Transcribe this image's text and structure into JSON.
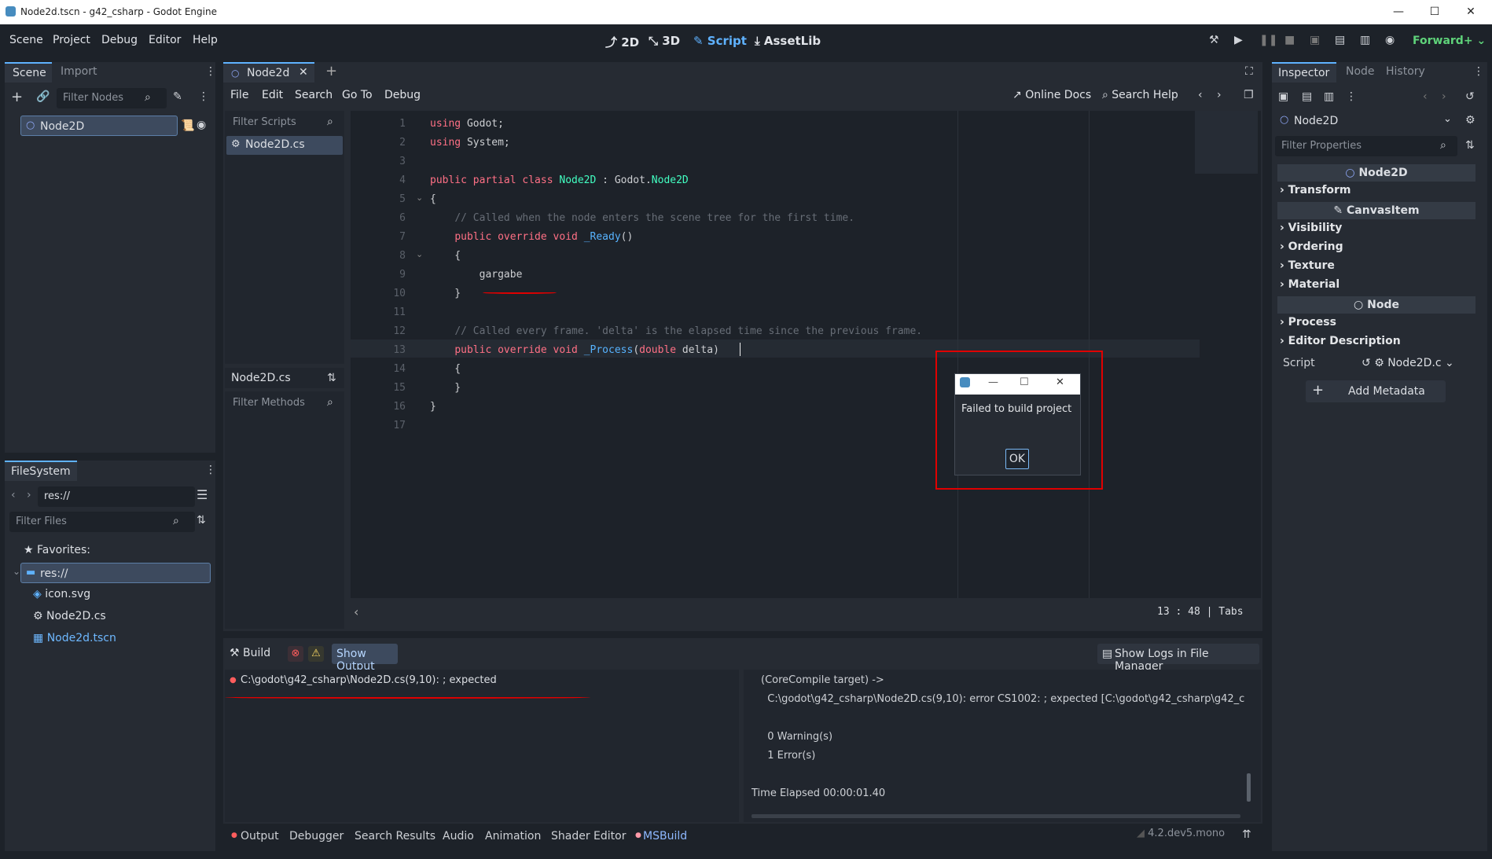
{
  "window": {
    "title": "Node2d.tscn - g42_csharp - Godot Engine",
    "minimize": "—",
    "maximize": "☐",
    "close": "✕"
  },
  "menu": {
    "items": [
      "Scene",
      "Project",
      "Debug",
      "Editor",
      "Help"
    ]
  },
  "workspaces": {
    "2d": "2D",
    "3d": "3D",
    "script": "Script",
    "assetlib": "AssetLib"
  },
  "renderer": "Forward+",
  "scene_dock": {
    "tab_scene": "Scene",
    "tab_import": "Import",
    "filter_placeholder": "Filter Nodes",
    "node": "Node2D"
  },
  "filesystem": {
    "tab": "FileSystem",
    "path": "res://",
    "filter_placeholder": "Filter Files",
    "favorites": "Favorites:",
    "root": "res://",
    "files": [
      "icon.svg",
      "Node2D.cs",
      "Node2d.tscn"
    ]
  },
  "editor_tabs": {
    "active": "Node2d",
    "add": "+"
  },
  "script_menu": {
    "items": [
      "File",
      "Edit",
      "Search",
      "Go To",
      "Debug"
    ],
    "online_docs": "Online Docs",
    "search_help": "Search Help"
  },
  "script_list": {
    "filter_placeholder": "Filter Scripts",
    "items": [
      "Node2D.cs"
    ],
    "current": "Node2D.cs",
    "methods_placeholder": "Filter Methods"
  },
  "code": {
    "lines": [
      [
        [
          "kw",
          "using"
        ],
        [
          "tx",
          " Godot;"
        ]
      ],
      [
        [
          "kw",
          "using"
        ],
        [
          "tx",
          " System;"
        ]
      ],
      [],
      [
        [
          "kw",
          "public partial class"
        ],
        [
          "tx",
          " "
        ],
        [
          "ty",
          "Node2D"
        ],
        [
          "tx",
          " : Godot."
        ],
        [
          "ty",
          "Node2D"
        ]
      ],
      [
        [
          "tx",
          "{"
        ]
      ],
      [
        [
          "tx",
          "    "
        ],
        [
          "cm",
          "// Called when the node enters the scene tree for the first time."
        ]
      ],
      [
        [
          "tx",
          "    "
        ],
        [
          "kw",
          "public override void"
        ],
        [
          "tx",
          " "
        ],
        [
          "fn",
          "_Ready"
        ],
        [
          "tx",
          "()"
        ]
      ],
      [
        [
          "tx",
          "    {"
        ]
      ],
      [
        [
          "tx",
          "        gargabe"
        ]
      ],
      [
        [
          "tx",
          "    }"
        ]
      ],
      [],
      [
        [
          "tx",
          "    "
        ],
        [
          "cm",
          "// Called every frame. 'delta' is the elapsed time since the previous frame."
        ]
      ],
      [
        [
          "tx",
          "    "
        ],
        [
          "kw",
          "public override void"
        ],
        [
          "tx",
          " "
        ],
        [
          "fn",
          "_Process"
        ],
        [
          "tx",
          "("
        ],
        [
          "kw",
          "double"
        ],
        [
          "tx",
          " delta)"
        ]
      ],
      [
        [
          "tx",
          "    {"
        ]
      ],
      [
        [
          "tx",
          "    }"
        ]
      ],
      [
        [
          "tx",
          "}"
        ]
      ],
      []
    ]
  },
  "status": {
    "line": "13",
    "col": "48",
    "sep": ":",
    "indent": "Tabs"
  },
  "dialog": {
    "message": "Failed to build project",
    "ok": "OK"
  },
  "build_panel": {
    "build": "Build",
    "show_output": "Show Output",
    "show_logs": "Show Logs in File Manager",
    "issue": "C:\\godot\\g42_csharp\\Node2D.cs(9,10): ; expected",
    "log": [
      "(CoreCompile target) ->",
      "  C:\\godot\\g42_csharp\\Node2D.cs(9,10): error CS1002: ; expected [C:\\godot\\g42_csharp\\g42_c",
      "",
      "  0 Warning(s)",
      "  1 Error(s)",
      "",
      "Time Elapsed 00:00:01.40"
    ]
  },
  "bottom_tabs": [
    "Output",
    "Debugger",
    "Search Results",
    "Audio",
    "Animation",
    "Shader Editor",
    "MSBuild"
  ],
  "version": "4.2.dev5.mono",
  "inspector": {
    "tabs": [
      "Inspector",
      "Node",
      "History"
    ],
    "object": "Node2D",
    "filter_placeholder": "Filter Properties",
    "sections": {
      "node2d": "Node2D",
      "transform": "Transform",
      "canvasitem": "CanvasItem",
      "visibility": "Visibility",
      "ordering": "Ordering",
      "texture": "Texture",
      "material": "Material",
      "node": "Node",
      "process": "Process",
      "editor_description": "Editor Description"
    },
    "script_label": "Script",
    "script_value": "Node2D.c",
    "add_metadata": "Add Metadata"
  },
  "colors": {
    "accent": "#5fb2ff",
    "error": "#ff5d5d",
    "highlight_box": "#e00000"
  }
}
